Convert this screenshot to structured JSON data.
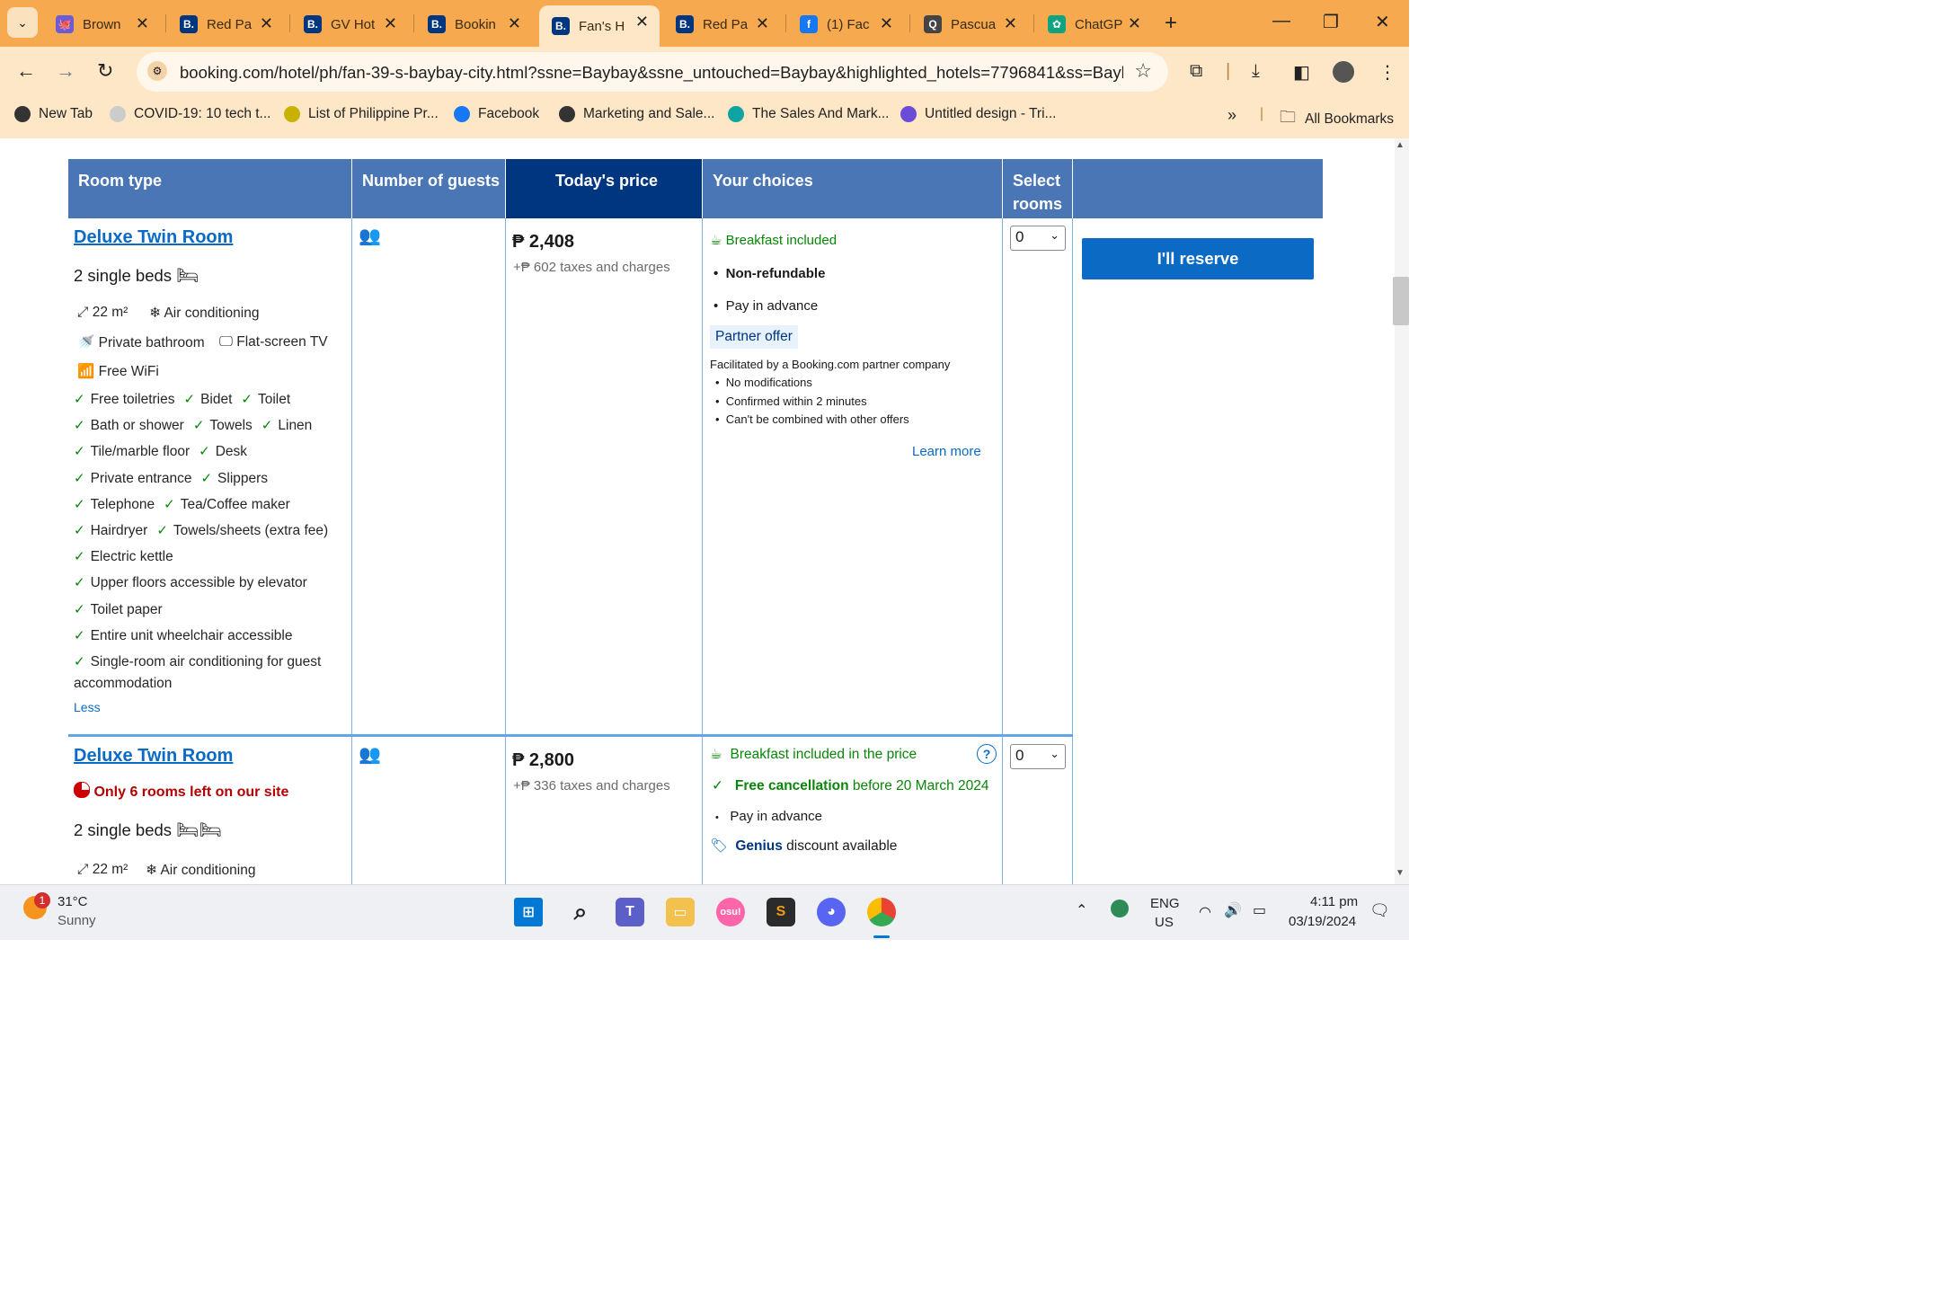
{
  "browser": {
    "tabs": [
      {
        "title": "Brown",
        "fav": "🐙",
        "fav_bg": "#6b5cd6"
      },
      {
        "title": "Red Pa",
        "fav": "B.",
        "fav_bg": "#003580"
      },
      {
        "title": "GV Hot",
        "fav": "B.",
        "fav_bg": "#003580"
      },
      {
        "title": "Bookin",
        "fav": "B.",
        "fav_bg": "#003580"
      },
      {
        "title": "Fan's H",
        "fav": "B.",
        "fav_bg": "#003580"
      },
      {
        "title": "Red Pa",
        "fav": "B.",
        "fav_bg": "#003580"
      },
      {
        "title": "(1) Fac",
        "fav": "f",
        "fav_bg": "#1877f2"
      },
      {
        "title": "Pascua",
        "fav": "Q",
        "fav_bg": "#444444"
      },
      {
        "title": "ChatGP",
        "fav": "✿",
        "fav_bg": "#10a37f"
      }
    ],
    "url": "booking.com/hotel/ph/fan-39-s-baybay-city.html?ssne=Baybay&ssne_untouched=Baybay&highlighted_hotels=7796841&ss=Bayba...",
    "bookmarks": [
      {
        "label": "New Tab",
        "icon": "globe-icon"
      },
      {
        "label": "COVID-19: 10 tech t...",
        "icon": "doc-icon"
      },
      {
        "label": "List of Philippine Pr...",
        "icon": "folder-icon"
      },
      {
        "label": "Facebook",
        "icon": "facebook-icon"
      },
      {
        "label": "Marketing and Sale...",
        "icon": "brace-icon"
      },
      {
        "label": "The Sales And Mark...",
        "icon": "triangle-icon"
      },
      {
        "label": "Untitled design - Tri...",
        "icon": "canva-icon"
      }
    ],
    "overflow": "»",
    "all_bookmarks": "All Bookmarks"
  },
  "table": {
    "headers": {
      "room_type": "Room type",
      "guests": "Number of guests",
      "price": "Today's price",
      "choices": "Your choices",
      "select": "Select rooms"
    }
  },
  "room1": {
    "name": "Deluxe Twin Room",
    "beds": "2 single beds",
    "size": "22 m²",
    "facilities": [
      "Air conditioning",
      "Private bathroom",
      "Flat-screen TV",
      "Free WiFi"
    ],
    "amenities_rows": [
      [
        "Free toiletries",
        "Bidet",
        "Toilet"
      ],
      [
        "Bath or shower",
        "Towels",
        "Linen"
      ],
      [
        "Tile/marble floor",
        "Desk"
      ],
      [
        "Private entrance",
        "Slippers"
      ],
      [
        "Telephone",
        "Tea/Coffee maker"
      ],
      [
        "Hairdryer",
        "Towels/sheets (extra fee)"
      ],
      [
        "Electric kettle"
      ],
      [
        "Upper floors accessible by elevator"
      ],
      [
        "Toilet paper"
      ],
      [
        "Entire unit wheelchair accessible"
      ],
      [
        "Single-room air conditioning for guest"
      ]
    ],
    "amenities_wrap": "accommodation",
    "less": "Less",
    "price": "₱ 2,408",
    "taxes": "+₱ 602 taxes and charges",
    "breakfast": "Breakfast included",
    "refund": "Non-refundable",
    "payment": "Pay in advance",
    "partner": "Partner offer",
    "partner_note": "Facilitated by a Booking.com partner company",
    "partner_bullets": [
      "No modifications",
      "Confirmed within 2 minutes",
      "Can't be combined with other offers"
    ],
    "learn_more": "Learn more",
    "select_value": "0",
    "reserve": "I'll reserve"
  },
  "room2": {
    "name": "Deluxe Twin Room",
    "scarcity": "Only 6 rooms left on our site",
    "beds": "2 single beds",
    "size": "22 m²",
    "facility": "Air conditioning",
    "price": "₱ 2,800",
    "taxes": "+₱ 336 taxes and charges",
    "breakfast": "Breakfast included in the price",
    "cancel_bold": "Free cancellation",
    "cancel_rest": "before 20 March 2024",
    "payment": "Pay in advance",
    "genius_bold": "Genius",
    "genius_rest": "discount available",
    "select_value": "0"
  },
  "taskbar": {
    "weather_temp": "31°C",
    "weather_desc": "Sunny",
    "weather_badge": "1",
    "lang_top": "ENG",
    "lang_bottom": "US",
    "time": "4:11 pm",
    "date": "03/19/2024"
  }
}
